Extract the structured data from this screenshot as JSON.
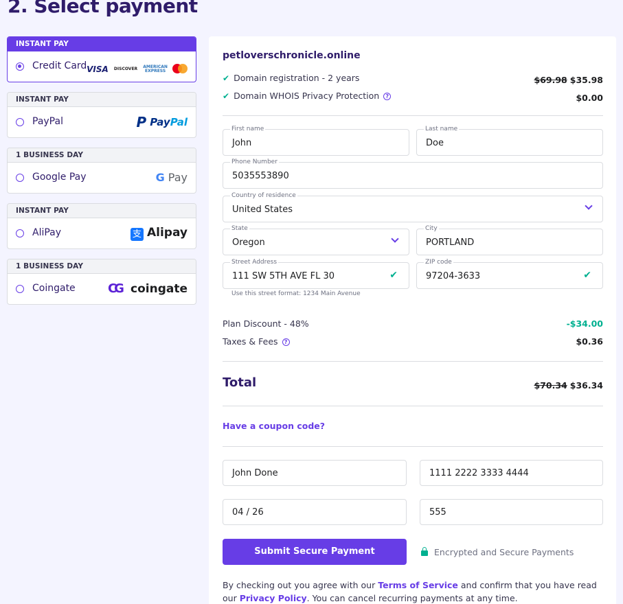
{
  "page": {
    "title": "2. Select payment"
  },
  "methods": [
    {
      "badge": "INSTANT PAY",
      "label": "Credit Card",
      "selected": true,
      "logo": "card-brands"
    },
    {
      "badge": "INSTANT PAY",
      "label": "PayPal",
      "selected": false,
      "logo": "PayPal"
    },
    {
      "badge": "1 BUSINESS DAY",
      "label": "Google Pay",
      "selected": false,
      "logo": "G Pay"
    },
    {
      "badge": "INSTANT PAY",
      "label": "AliPay",
      "selected": false,
      "logo": "Alipay"
    },
    {
      "badge": "1 BUSINESS DAY",
      "label": "Coingate",
      "selected": false,
      "logo": "coingate"
    }
  ],
  "logos": {
    "visa": "VISA",
    "discover": "DISCOVER",
    "amex_top": "AMERICAN",
    "amex_bottom": "EXPRESS",
    "paypal_a": "Pay",
    "paypal_b": "Pal",
    "gpay_g": "G",
    "gpay_pay": "Pay",
    "alipay": "Alipay",
    "alipay_mark": "支",
    "coingate": "coingate"
  },
  "order": {
    "domain": "petloverschronicle.online",
    "items": [
      {
        "label": "Domain registration - 2 years",
        "old_price": "$69.98",
        "price": "$35.98"
      },
      {
        "label": "Domain WHOIS Privacy Protection",
        "old_price": "",
        "price": "$0.00",
        "help": "?"
      }
    ]
  },
  "form": {
    "first_name": {
      "label": "First name",
      "value": "John"
    },
    "last_name": {
      "label": "Last name",
      "value": "Doe"
    },
    "phone": {
      "label": "Phone Number",
      "value": "5035553890"
    },
    "country": {
      "label": "Country of residence",
      "value": "United States"
    },
    "state": {
      "label": "State",
      "value": "Oregon"
    },
    "city": {
      "label": "City",
      "value": "PORTLAND"
    },
    "street": {
      "label": "Street Address",
      "value": "111 SW 5TH AVE FL 30",
      "hint": "Use this street format: 1234 Main Avenue"
    },
    "zip": {
      "label": "ZIP code",
      "value": "97204-3633"
    }
  },
  "summary": {
    "discount_label": "Plan Discount - 48%",
    "discount_value": "-$34.00",
    "taxes_label": "Taxes & Fees",
    "taxes_value": "$0.36",
    "total_label": "Total",
    "total_old": "$70.34",
    "total_value": "$36.34"
  },
  "coupon": {
    "label": "Have a coupon code?"
  },
  "card": {
    "holder": "John Done",
    "number": "1111 2222 3333 4444",
    "expiry": "04 / 26",
    "cvc": "555"
  },
  "submit": {
    "label": "Submit Secure Payment"
  },
  "secure_note": "Encrypted and Secure Payments",
  "terms": {
    "part1": "By checking out you agree with our ",
    "tos": "Terms of Service",
    "part2": " and confirm that you have read our ",
    "privacy": "Privacy Policy",
    "part3": ". You can cancel recurring payments at any time."
  },
  "colors": {
    "accent": "#673de6",
    "title": "#2f1c6a",
    "success": "#00b090",
    "background": "#f4f4ff"
  }
}
